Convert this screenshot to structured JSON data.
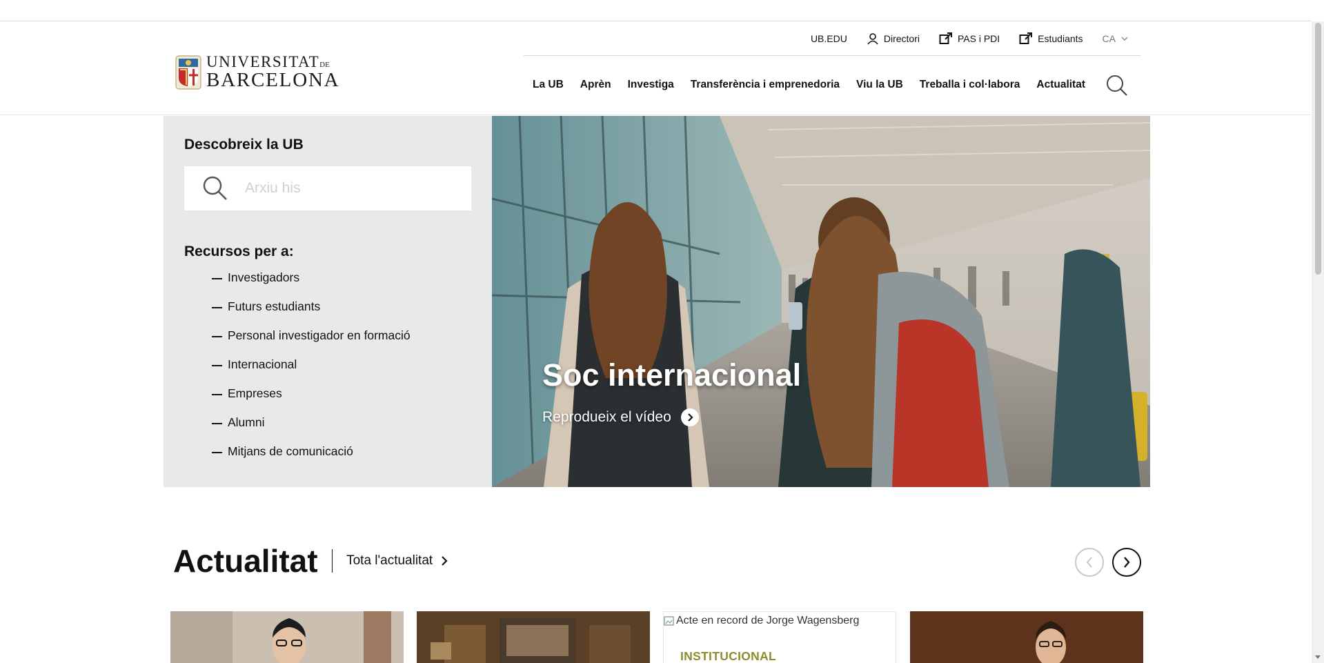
{
  "logo": {
    "line1": "UNIVERSITAT",
    "line1_suffix": "DE",
    "line2": "BARCELONA"
  },
  "utility_nav": {
    "ubedu": "UB.EDU",
    "directori": "Directori",
    "pas_pdi": "PAS i PDI",
    "estudiants": "Estudiants",
    "language": "CA"
  },
  "main_nav": [
    {
      "label": "La UB"
    },
    {
      "label": "Aprèn"
    },
    {
      "label": "Investiga"
    },
    {
      "label": "Transferència i emprenedoria"
    },
    {
      "label": "Viu la UB"
    },
    {
      "label": "Treballa i col·labora"
    },
    {
      "label": "Actualitat"
    }
  ],
  "discover": {
    "title": "Descobreix la UB",
    "search_placeholder": "Arxiu his",
    "resources_title": "Recursos per a:",
    "resources": [
      {
        "label": "Investigadors"
      },
      {
        "label": "Futurs estudiants"
      },
      {
        "label": "Personal investigador en formació"
      },
      {
        "label": "Internacional"
      },
      {
        "label": "Empreses"
      },
      {
        "label": "Alumni"
      },
      {
        "label": "Mitjans de comunicació"
      }
    ]
  },
  "hero": {
    "title": "Soc internacional",
    "play_label": "Reprodueix el vídeo"
  },
  "news": {
    "title": "Actualitat",
    "all_link": "Tota l'actualitat",
    "cards": [
      {
        "image_alt": "",
        "category": ""
      },
      {
        "image_alt": "",
        "category": ""
      },
      {
        "image_alt": "Acte en record de Jorge Wagensberg",
        "category": "INSTITUCIONAL"
      },
      {
        "image_alt": "",
        "category": ""
      }
    ]
  },
  "colors": {
    "panel_bg": "#e9e9e9",
    "category_olive": "#8a8f2c",
    "text_dark": "#111111"
  }
}
